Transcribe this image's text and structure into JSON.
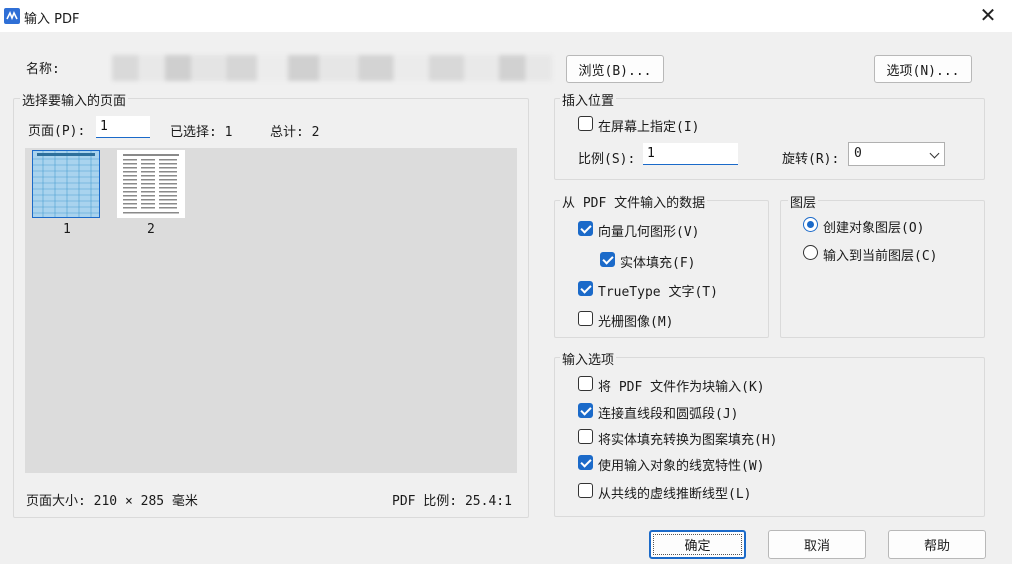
{
  "window": {
    "title": "输入 PDF",
    "close_glyph": "✕"
  },
  "name_row": {
    "label": "名称:",
    "browse_button": "浏览(B)...",
    "options_button": "选项(N)..."
  },
  "pages_group": {
    "title": "选择要输入的页面",
    "page_label": "页面(P):",
    "page_value": "1",
    "selected_text": "已选择: 1",
    "total_text": "总计: 2",
    "thumbnails": [
      {
        "label": "1"
      },
      {
        "label": "2"
      }
    ],
    "page_size_text": "页面大小: 210 × 285 毫米",
    "pdf_scale_text": "PDF 比例: 25.4:1"
  },
  "insert_group": {
    "title": "插入位置",
    "specify_on_screen": {
      "label": "在屏幕上指定(I)",
      "checked": false
    },
    "scale_label": "比例(S):",
    "scale_value": "1",
    "rotation_label": "旋转(R):",
    "rotation_value": "0"
  },
  "data_group": {
    "title": "从 PDF 文件输入的数据",
    "vector": {
      "label": "向量几何图形(V)",
      "checked": true
    },
    "solid_fill": {
      "label": "实体填充(F)",
      "checked": true
    },
    "truetype": {
      "label": "TrueType 文字(T)",
      "checked": true
    },
    "raster": {
      "label": "光栅图像(M)",
      "checked": false
    }
  },
  "layer_group": {
    "title": "图层",
    "create_object_layer": {
      "label": "创建对象图层(O)",
      "selected": true
    },
    "current_layer": {
      "label": "输入到当前图层(C)",
      "selected": false
    }
  },
  "import_options": {
    "title": "输入选项",
    "as_block": {
      "label": "将 PDF 文件作为块输入(K)",
      "checked": false
    },
    "join_segments": {
      "label": "连接直线段和圆弧段(J)",
      "checked": true
    },
    "convert_fill": {
      "label": "将实体填充转换为图案填充(H)",
      "checked": false
    },
    "lineweight": {
      "label": "使用输入对象的线宽特性(W)",
      "checked": true
    },
    "infer_linetype": {
      "label": "从共线的虚线推断线型(L)",
      "checked": false
    }
  },
  "footer": {
    "ok": "确定",
    "cancel": "取消",
    "help": "帮助"
  },
  "colors": {
    "accent": "#1b6ac9",
    "background": "#f0f0f0"
  }
}
